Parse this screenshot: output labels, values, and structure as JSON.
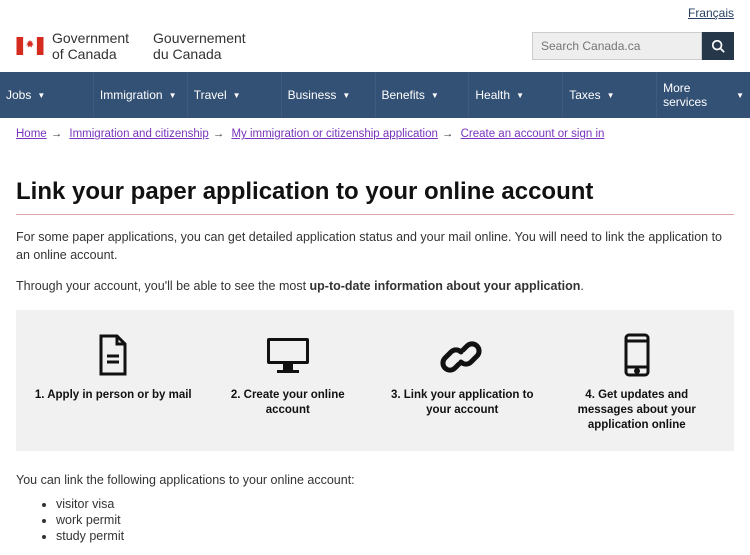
{
  "lang_link": "Français",
  "gov": {
    "en_l1": "Government",
    "en_l2": "of Canada",
    "fr_l1": "Gouvernement",
    "fr_l2": "du Canada"
  },
  "search": {
    "placeholder": "Search Canada.ca"
  },
  "nav": [
    "Jobs",
    "Immigration",
    "Travel",
    "Business",
    "Benefits",
    "Health",
    "Taxes",
    "More services"
  ],
  "breadcrumb": {
    "home": "Home",
    "b1": "Immigration and citizenship",
    "b2": "My immigration or citizenship application",
    "b3": "Create an account or sign in"
  },
  "title": "Link your paper application to your online account",
  "p1": "For some paper applications, you can get detailed application status and your mail online. You will need to link the application to an online account.",
  "p2a": "Through your account, you'll be able to see the most ",
  "p2b": "up-to-date information about your application",
  "p2c": ".",
  "steps": {
    "s1": "1. Apply in person or by mail",
    "s2": "2. Create your online account",
    "s3": "3. Link your application to your account",
    "s4": "4. Get updates and messages about your application online"
  },
  "list_intro": "You can link the following applications to your online account:",
  "apps": [
    "visitor visa",
    "work permit",
    "study permit"
  ]
}
